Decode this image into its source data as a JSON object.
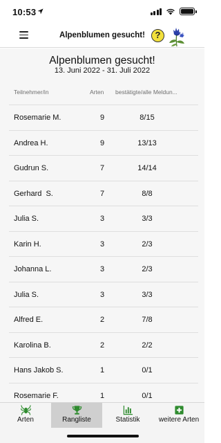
{
  "status_bar": {
    "time": "10:53"
  },
  "nav": {
    "title": "Alpenblumen gesucht!",
    "help_glyph": "?"
  },
  "header": {
    "title": "Alpenblumen gesucht!",
    "date_range": "13. Juni 2022 - 31. Juli 2022"
  },
  "table": {
    "columns": {
      "name": "Teilnehmer/in",
      "species": "Arten",
      "reports": "bestätigte/alle Meldun..."
    },
    "rows": [
      {
        "name": "Rosemarie M.",
        "species": "9",
        "reports": "8/15"
      },
      {
        "name": "Andrea H.",
        "species": "9",
        "reports": "13/13"
      },
      {
        "name": "Gudrun S.",
        "species": "7",
        "reports": "14/14"
      },
      {
        "name": "Gerhard  S.",
        "species": "7",
        "reports": "8/8"
      },
      {
        "name": "Julia S.",
        "species": "3",
        "reports": "3/3"
      },
      {
        "name": "Karin H.",
        "species": "3",
        "reports": "2/3"
      },
      {
        "name": "Johanna L.",
        "species": "3",
        "reports": "2/3"
      },
      {
        "name": "Julia S.",
        "species": "3",
        "reports": "3/3"
      },
      {
        "name": "Alfred E.",
        "species": "2",
        "reports": "7/8"
      },
      {
        "name": "Karolina B.",
        "species": "2",
        "reports": "2/2"
      },
      {
        "name": "Hans Jakob S.",
        "species": "1",
        "reports": "0/1"
      },
      {
        "name": "Rosemarie F.",
        "species": "1",
        "reports": "0/1"
      }
    ]
  },
  "tabs": [
    {
      "label": "Arten",
      "icon": "spider-icon",
      "color": "#2e8b2e"
    },
    {
      "label": "Rangliste",
      "icon": "trophy-icon",
      "color": "#2e8b2e",
      "active": true
    },
    {
      "label": "Statistik",
      "icon": "bar-chart-icon",
      "color": "#2e8b2e"
    },
    {
      "label": "weitere Arten",
      "icon": "plus-box-icon",
      "color": "#2e8b2e"
    }
  ],
  "colors": {
    "accent_green": "#2e8b2e",
    "help_yellow": "#f2e03c",
    "active_tab_bg": "#cfcfcf"
  }
}
